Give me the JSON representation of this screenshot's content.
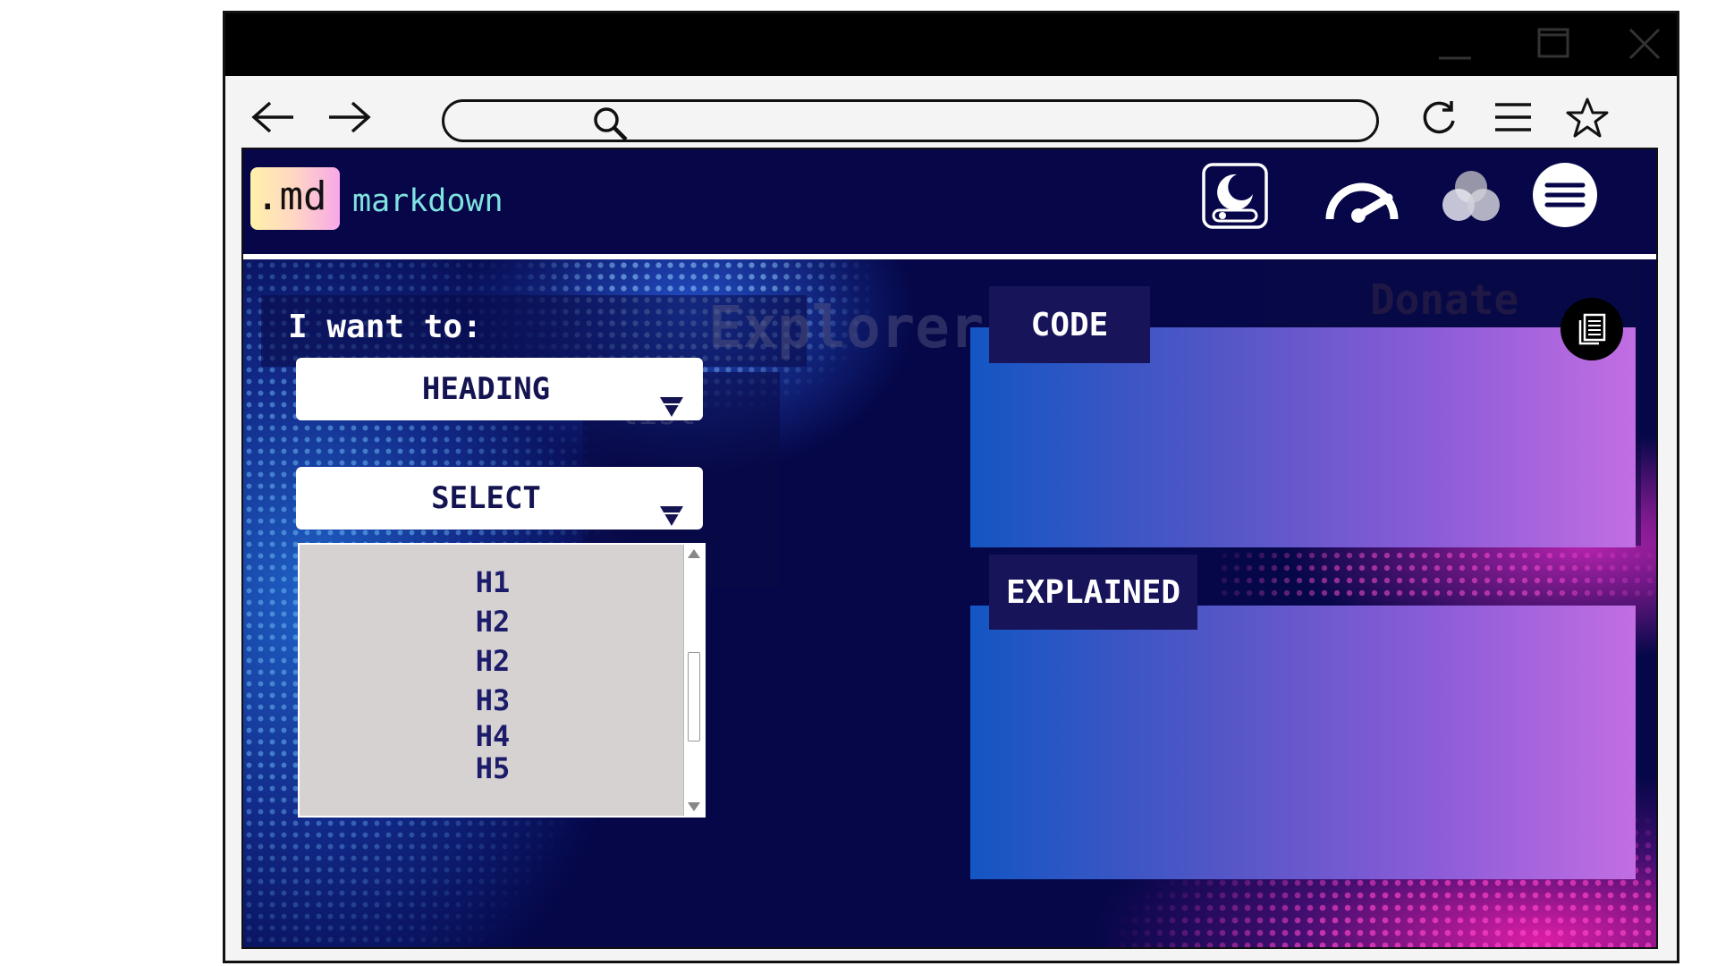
{
  "app": {
    "logo_badge": ".md",
    "logo_text": "markdown"
  },
  "browser": {
    "url": "",
    "icons": [
      "back-arrow-icon",
      "forward-arrow-icon",
      "search-icon",
      "reload-icon",
      "hamburger-menu-icon",
      "star-icon",
      "minimize-icon",
      "maximize-icon",
      "close-icon"
    ]
  },
  "header": {
    "icons": [
      "dark-mode-toggle-icon",
      "speedometer-icon",
      "color-blend-icon",
      "menu-icon"
    ]
  },
  "form": {
    "prompt_label": "I want to:",
    "action_dropdown": {
      "selected": "HEADING"
    },
    "type_dropdown": {
      "selected": "SELECT"
    },
    "listbox_options": [
      "H1",
      "H2",
      "H2",
      "H3",
      "H4",
      "H5"
    ]
  },
  "panels": {
    "code_tab": "CODE",
    "explained_tab": "EXPLAINED"
  },
  "background_text": {
    "explorer": "Explorer",
    "list": "list",
    "donate": "Donate"
  },
  "colors": {
    "background": "#050748",
    "panel_gradient_start": "#1356c3",
    "panel_gradient_end": "#c26ee2",
    "logo_text": "#7fe3df"
  }
}
